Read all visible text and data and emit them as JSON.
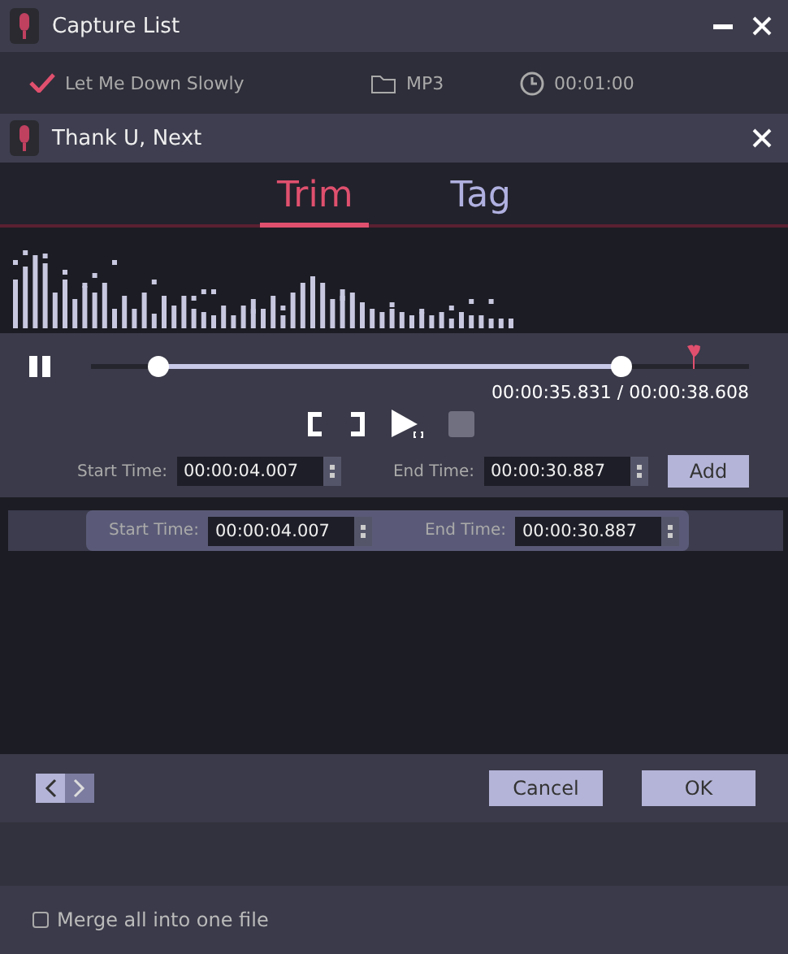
{
  "window": {
    "title": "Capture List"
  },
  "capture_item": {
    "checked": true,
    "name": "Let Me Down Slowly",
    "format": "MP3",
    "duration": "00:01:00"
  },
  "dialog": {
    "title": "Thank U, Next"
  },
  "tabs": [
    {
      "label": "Trim",
      "selected": true
    },
    {
      "label": "Tag",
      "selected": false
    }
  ],
  "timeline": {
    "trim_start": {
      "level": 0.087
    },
    "trim_end": {
      "level": 0.817
    },
    "playhead": {
      "level": 0.93
    },
    "time": "00:00:35.831 / 00:00:38.608"
  },
  "editor": {
    "start_label": "Start Time:",
    "start_value": "00:00:04.007",
    "end_label": "End Time:",
    "end_value": "00:00:30.887",
    "add_button": "Add"
  },
  "segments": [
    {
      "start_label": "Start Time:",
      "start_value": "00:00:04.007",
      "end_label": "End Time:",
      "end_value": "00:00:30.887",
      "selected": true
    }
  ],
  "buttons": {
    "cancel": "Cancel",
    "ok": "OK"
  },
  "merge": {
    "label": "Merge all into one file",
    "checked": false
  }
}
